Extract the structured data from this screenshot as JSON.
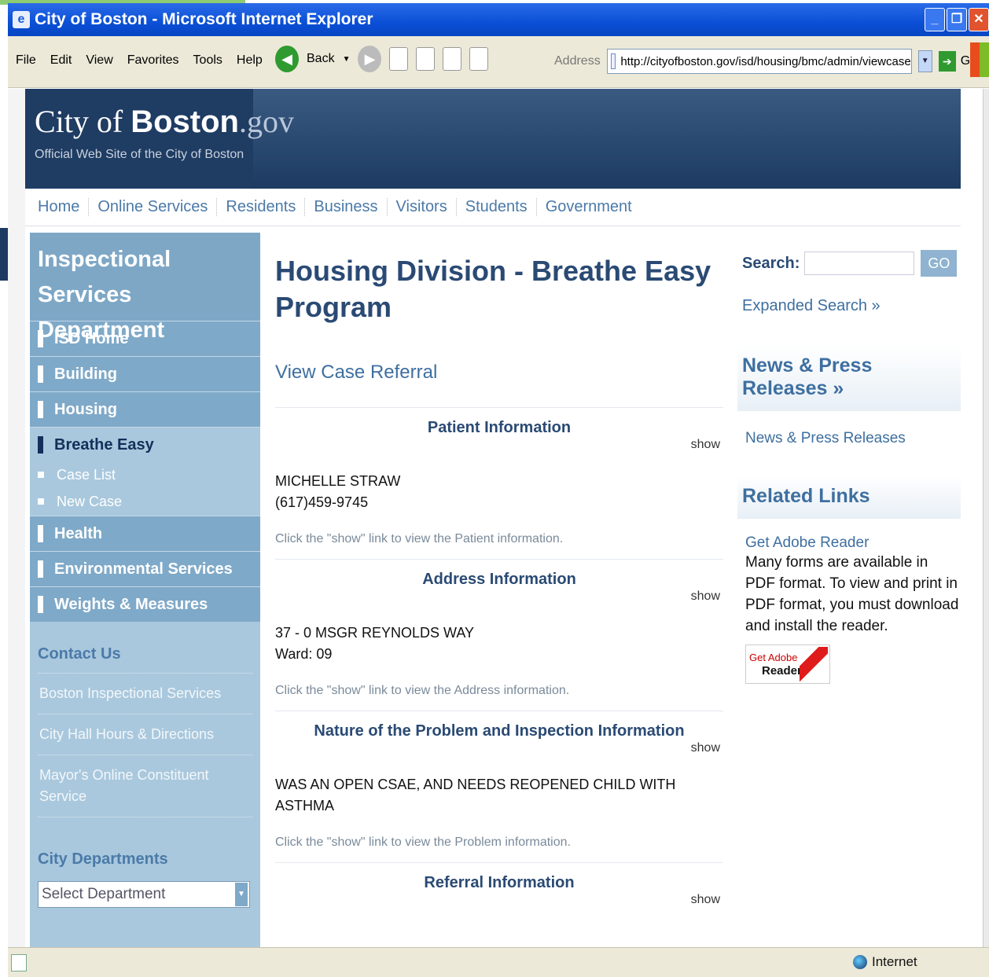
{
  "window": {
    "title": "City of Boston - Microsoft Internet Explorer"
  },
  "menu": [
    "File",
    "Edit",
    "View",
    "Favorites",
    "Tools",
    "Help"
  ],
  "toolbar": {
    "back_label": "Back",
    "address_label": "Address",
    "address_url": "http://cityofboston.gov/isd/housing/bmc/admin/viewcase",
    "go_label": "Go"
  },
  "site": {
    "logo_city": "City of ",
    "logo_boston": "Boston",
    "logo_gov": ".gov",
    "tagline": "Official Web Site of the City of Boston"
  },
  "nav": [
    "Home",
    "Online Services",
    "Residents",
    "Business",
    "Visitors",
    "Students",
    "Government"
  ],
  "sidebar": {
    "title": "Inspectional Services Department",
    "items": [
      "ISD Home",
      "Building",
      "Housing",
      "Breathe Easy"
    ],
    "subitems": [
      "Case List",
      "New Case"
    ],
    "items2": [
      "Health",
      "Environmental Services",
      "Weights & Measures"
    ],
    "contact_heading": "Contact Us",
    "contact_links": [
      "Boston Inspectional Services",
      "City Hall Hours & Directions",
      "Mayor's Online Constituent Service"
    ],
    "departments_heading": "City Departments",
    "select_value": "Select Department"
  },
  "main": {
    "title": "Housing Division - Breathe Easy Program",
    "subtitle": "View Case Referral",
    "show_label": "show",
    "sections": [
      {
        "heading": "Patient Information",
        "lines": [
          "MICHELLE STRAW",
          "(617)459-9745"
        ],
        "note": "Click the \"show\" link to view the Patient information."
      },
      {
        "heading": "Address Information",
        "lines": [
          "37 - 0 MSGR REYNOLDS WAY",
          "Ward: 09"
        ],
        "note": "Click the \"show\" link to view the Address information."
      },
      {
        "heading": "Nature of the Problem and Inspection Information",
        "lines": [
          "WAS AN OPEN CSAE, AND NEEDS REOPENED CHILD WITH ASTHMA"
        ],
        "note": "Click the \"show\" link to view the Problem information."
      },
      {
        "heading": "Referral Information",
        "lines": [],
        "note": ""
      }
    ]
  },
  "right": {
    "search_label": "Search:",
    "search_button": "GO",
    "expanded_search": "Expanded Search »",
    "news_heading": "News & Press Releases »",
    "news_link": "News & Press Releases",
    "related_heading": "Related Links",
    "adobe_link": "Get Adobe Reader",
    "adobe_text": "Many forms are available in PDF format. To view and print in PDF format, you must download and install the reader.",
    "adobe_badge_top": "Get Adobe",
    "adobe_badge_bottom": "Reader"
  },
  "status": {
    "zone": "Internet"
  }
}
